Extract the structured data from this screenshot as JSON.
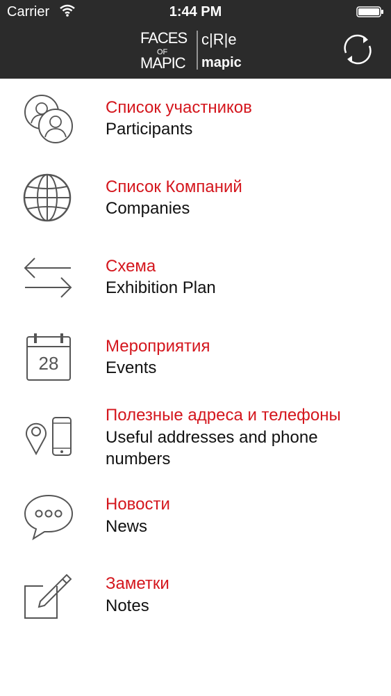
{
  "status_bar": {
    "carrier": "Carrier",
    "time": "1:44 PM"
  },
  "header": {
    "logo_text": {
      "left_top": "FACES",
      "left_mid": "OF",
      "left_bottom": "MAPIC",
      "right_top": "c|R|e",
      "right_bottom": "mapic"
    },
    "refresh_icon": "refresh-icon",
    "background": "#2b2b2b"
  },
  "menu": {
    "accent_color": "#d4161d",
    "items": [
      {
        "title_ru": "Список участников",
        "title_en": "Participants",
        "icon": "participants-icon"
      },
      {
        "title_ru": "Список Компаний",
        "title_en": "Companies",
        "icon": "globe-icon"
      },
      {
        "title_ru": "Схема",
        "title_en": "Exhibition Plan",
        "icon": "arrows-icon"
      },
      {
        "title_ru": "Мероприятия",
        "title_en": "Events",
        "icon": "calendar-icon",
        "calendar_day": "28"
      },
      {
        "title_ru": "Полезные адреса и телефоны",
        "title_en": "Useful addresses and phone numbers",
        "icon": "pin-phone-icon"
      },
      {
        "title_ru": "Новости",
        "title_en": "News",
        "icon": "chat-bubble-icon"
      },
      {
        "title_ru": "Заметки",
        "title_en": "Notes",
        "icon": "notes-icon"
      }
    ]
  }
}
